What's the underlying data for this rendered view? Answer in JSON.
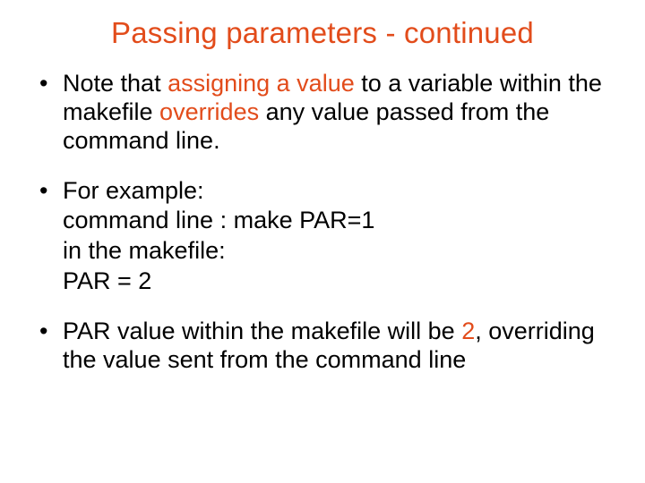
{
  "accent_color": "#e24c1b",
  "title": "Passing parameters - continued",
  "bullets": [
    {
      "pre1": "Note that ",
      "kw1": "assigning a value",
      "mid1": " to a variable within the makefile ",
      "kw2": "overrides",
      "post1": " any value passed from the command line."
    },
    {
      "l1": "For example:",
      "l2": "command line : make PAR=1",
      "l3": "in the makefile:",
      "l4": "PAR = 2"
    },
    {
      "pre": "PAR value within the makefile will be ",
      "val": "2",
      "post": ", overriding the value sent from the command line"
    }
  ]
}
